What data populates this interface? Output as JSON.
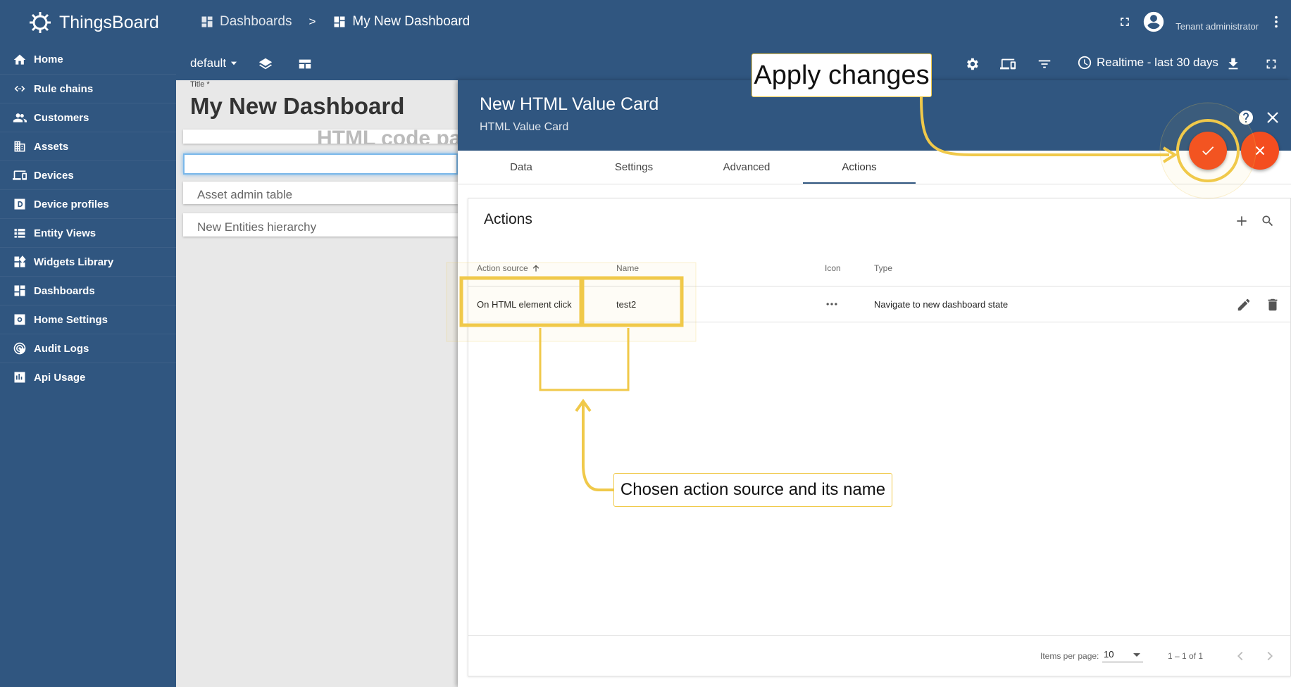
{
  "app": {
    "name": "ThingsBoard"
  },
  "sidebar": {
    "items": [
      {
        "label": "Home",
        "icon": "home-icon"
      },
      {
        "label": "Rule chains",
        "icon": "rule-chain-icon"
      },
      {
        "label": "Customers",
        "icon": "customers-icon"
      },
      {
        "label": "Assets",
        "icon": "assets-icon"
      },
      {
        "label": "Devices",
        "icon": "devices-icon"
      },
      {
        "label": "Device profiles",
        "icon": "device-profile-icon"
      },
      {
        "label": "Entity Views",
        "icon": "entity-views-icon"
      },
      {
        "label": "Widgets Library",
        "icon": "widgets-icon"
      },
      {
        "label": "Dashboards",
        "icon": "dashboards-icon"
      },
      {
        "label": "Home Settings",
        "icon": "settings-icon"
      },
      {
        "label": "Audit Logs",
        "icon": "audit-icon"
      },
      {
        "label": "Api Usage",
        "icon": "api-usage-icon"
      }
    ]
  },
  "header": {
    "breadcrumb": [
      {
        "label": "Dashboards"
      },
      {
        "label": "My New Dashboard"
      }
    ],
    "separator": ">",
    "user_role": "Tenant administrator",
    "state": "default",
    "timewindow": "Realtime - last 30 days"
  },
  "dashboard": {
    "title_label": "Title *",
    "title": "My New Dashboard",
    "html_card_fragment": "HTML code pa",
    "cards": [
      "Asset admin table",
      "New Entities hierarchy"
    ]
  },
  "panel": {
    "title": "New HTML Value Card",
    "subtitle": "HTML Value Card",
    "tabs": [
      "Data",
      "Settings",
      "Advanced",
      "Actions"
    ],
    "active_tab": "Actions",
    "actions": {
      "title": "Actions",
      "columns": {
        "source": "Action source",
        "name": "Name",
        "icon": "Icon",
        "type": "Type"
      },
      "rows": [
        {
          "source": "On HTML element click",
          "name": "test2",
          "icon": "more-horiz-icon",
          "type": "Navigate to new dashboard state"
        }
      ],
      "paginator": {
        "items_per_page_label": "Items per page:",
        "items_per_page": "10",
        "range": "1 – 1 of 1"
      }
    }
  },
  "annotations": {
    "apply": "Apply changes",
    "chosen": "Chosen action source and its name"
  },
  "colors": {
    "primary": "#305680",
    "accent": "#f44d1f",
    "highlight": "#f0c94a"
  }
}
